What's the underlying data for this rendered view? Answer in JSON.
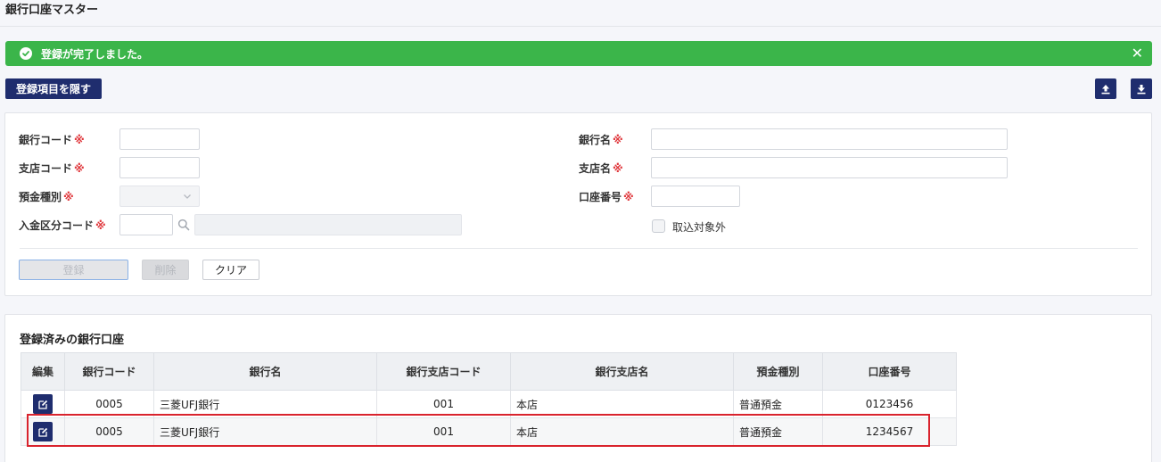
{
  "page": {
    "title": "銀行口座マスター"
  },
  "alert": {
    "message": "登録が完了しました。",
    "close": "✕"
  },
  "toolbar": {
    "hide_label": "登録項目を隠す"
  },
  "form": {
    "bank_code_label": "銀行コード",
    "branch_code_label": "支店コード",
    "deposit_type_label": "預金種別",
    "payment_code_label": "入金区分コード",
    "bank_name_label": "銀行名",
    "branch_name_label": "支店名",
    "account_no_label": "口座番号",
    "exclude_label": "取込対象外",
    "required_mark": "※",
    "bank_code_value": "",
    "branch_code_value": "",
    "bank_name_value": "",
    "branch_name_value": "",
    "account_no_value": "",
    "payment_code_value": ""
  },
  "buttons": {
    "register": "登録",
    "delete": "削除",
    "clear": "クリア"
  },
  "list": {
    "title": "登録済みの銀行口座",
    "headers": [
      "編集",
      "銀行コード",
      "銀行名",
      "銀行支店コード",
      "銀行支店名",
      "預金種別",
      "口座番号"
    ],
    "rows": [
      {
        "bank_code": "0005",
        "bank_name": "三菱UFJ銀行",
        "branch_code": "001",
        "branch_name": "本店",
        "deposit_type": "普通預金",
        "account_no": "0123456"
      },
      {
        "bank_code": "0005",
        "bank_name": "三菱UFJ銀行",
        "branch_code": "001",
        "branch_name": "本店",
        "deposit_type": "普通預金",
        "account_no": "1234567"
      }
    ]
  },
  "colors": {
    "accent": "#1f2d6e",
    "success": "#3bb54a",
    "required": "#e0393e",
    "highlight": "#d9232d"
  }
}
